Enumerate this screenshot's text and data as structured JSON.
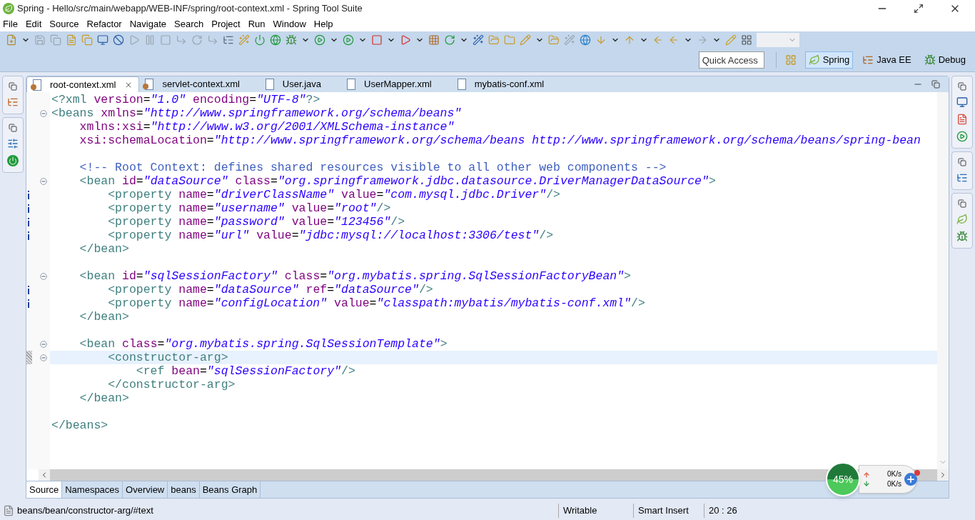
{
  "window": {
    "title": "Spring - Hello/src/main/webapp/WEB-INF/spring/root-context.xml - Spring Tool Suite"
  },
  "menu": [
    "File",
    "Edit",
    "Source",
    "Refactor",
    "Navigate",
    "Search",
    "Project",
    "Run",
    "Window",
    "Help"
  ],
  "quick_access": {
    "placeholder": "Quick Access"
  },
  "perspectives": [
    {
      "label": "Spring",
      "selected": true
    },
    {
      "label": "Java EE",
      "selected": false
    },
    {
      "label": "Debug",
      "selected": false
    }
  ],
  "editor_tabs": [
    {
      "label": "root-context.xml",
      "selected": true,
      "kind": "spring"
    },
    {
      "label": "servlet-context.xml",
      "selected": false,
      "kind": "spring"
    },
    {
      "label": "User.java",
      "selected": false,
      "kind": "java"
    },
    {
      "label": "UserMapper.xml",
      "selected": false,
      "kind": "xml"
    },
    {
      "label": "mybatis-conf.xml",
      "selected": false,
      "kind": "xml"
    }
  ],
  "code_lines": [
    {
      "fold": false,
      "info": false,
      "current": false,
      "changed": false,
      "segments": [
        {
          "kind": "tag",
          "text": "<?xml"
        },
        {
          "kind": "attr",
          "text": " version"
        },
        {
          "kind": "plain",
          "text": "="
        },
        {
          "kind": "value",
          "text": "\"1.0\""
        },
        {
          "kind": "attr",
          "text": " encoding"
        },
        {
          "kind": "plain",
          "text": "="
        },
        {
          "kind": "value",
          "text": "\"UTF-8\""
        },
        {
          "kind": "tag",
          "text": "?>"
        }
      ]
    },
    {
      "fold": true,
      "info": false,
      "current": false,
      "changed": false,
      "segments": [
        {
          "kind": "tag",
          "text": "<beans"
        },
        {
          "kind": "attr",
          "text": " xmlns"
        },
        {
          "kind": "plain",
          "text": "="
        },
        {
          "kind": "value",
          "text": "\"http://www.springframework.org/schema/beans\""
        }
      ]
    },
    {
      "fold": false,
      "info": false,
      "current": false,
      "changed": false,
      "segments": [
        {
          "kind": "attr",
          "text": "    xmlns:xsi"
        },
        {
          "kind": "plain",
          "text": "="
        },
        {
          "kind": "value",
          "text": "\"http://www.w3.org/2001/XMLSchema-instance\""
        }
      ]
    },
    {
      "fold": false,
      "info": false,
      "current": false,
      "changed": false,
      "segments": [
        {
          "kind": "attr",
          "text": "    xsi:schemaLocation"
        },
        {
          "kind": "plain",
          "text": "="
        },
        {
          "kind": "value",
          "text": "\"http://www.springframework.org/schema/beans http://www.springframework.org/schema/beans/spring-bean"
        }
      ]
    },
    {
      "fold": false,
      "info": false,
      "current": false,
      "changed": false
    },
    {
      "fold": false,
      "info": false,
      "current": false,
      "changed": false,
      "segments": [
        {
          "kind": "comment",
          "text": "    <!-- Root Context: defines shared resources visible to all other web components -->"
        }
      ]
    },
    {
      "fold": true,
      "info": false,
      "current": false,
      "changed": false,
      "segments": [
        {
          "kind": "tag",
          "text": "    <bean"
        },
        {
          "kind": "attr",
          "text": " id"
        },
        {
          "kind": "plain",
          "text": "="
        },
        {
          "kind": "value",
          "text": "\"dataSource\""
        },
        {
          "kind": "attr",
          "text": " class"
        },
        {
          "kind": "plain",
          "text": "="
        },
        {
          "kind": "value",
          "text": "\"org.springframework.jdbc.datasource.DriverManagerDataSource\""
        },
        {
          "kind": "tag",
          "text": ">"
        }
      ]
    },
    {
      "fold": false,
      "info": true,
      "current": false,
      "changed": false,
      "segments": [
        {
          "kind": "tag",
          "text": "        <property"
        },
        {
          "kind": "attr",
          "text": " name"
        },
        {
          "kind": "plain",
          "text": "="
        },
        {
          "kind": "value",
          "text": "\"driverClassName\""
        },
        {
          "kind": "attr",
          "text": " value"
        },
        {
          "kind": "plain",
          "text": "="
        },
        {
          "kind": "value",
          "text": "\"com.mysql.jdbc.Driver\""
        },
        {
          "kind": "tag",
          "text": "/>"
        }
      ]
    },
    {
      "fold": false,
      "info": true,
      "current": false,
      "changed": false,
      "segments": [
        {
          "kind": "tag",
          "text": "        <property"
        },
        {
          "kind": "attr",
          "text": " name"
        },
        {
          "kind": "plain",
          "text": "="
        },
        {
          "kind": "value",
          "text": "\"username\""
        },
        {
          "kind": "attr",
          "text": " value"
        },
        {
          "kind": "plain",
          "text": "="
        },
        {
          "kind": "value",
          "text": "\"root\""
        },
        {
          "kind": "tag",
          "text": "/>"
        }
      ]
    },
    {
      "fold": false,
      "info": true,
      "current": false,
      "changed": false,
      "segments": [
        {
          "kind": "tag",
          "text": "        <property"
        },
        {
          "kind": "attr",
          "text": " name"
        },
        {
          "kind": "plain",
          "text": "="
        },
        {
          "kind": "value",
          "text": "\"password\""
        },
        {
          "kind": "attr",
          "text": " value"
        },
        {
          "kind": "plain",
          "text": "="
        },
        {
          "kind": "value",
          "text": "\"123456\""
        },
        {
          "kind": "tag",
          "text": "/>"
        }
      ]
    },
    {
      "fold": false,
      "info": true,
      "current": false,
      "changed": false,
      "segments": [
        {
          "kind": "tag",
          "text": "        <property"
        },
        {
          "kind": "attr",
          "text": " name"
        },
        {
          "kind": "plain",
          "text": "="
        },
        {
          "kind": "value",
          "text": "\"url\""
        },
        {
          "kind": "attr",
          "text": " value"
        },
        {
          "kind": "plain",
          "text": "="
        },
        {
          "kind": "value",
          "text": "\"jdbc:mysql://localhost:3306/test\""
        },
        {
          "kind": "tag",
          "text": "/>"
        }
      ]
    },
    {
      "fold": false,
      "info": false,
      "current": false,
      "changed": false,
      "segments": [
        {
          "kind": "tag",
          "text": "    </bean>"
        }
      ]
    },
    {
      "fold": false,
      "info": false,
      "current": false,
      "changed": false
    },
    {
      "fold": true,
      "info": false,
      "current": false,
      "changed": false,
      "segments": [
        {
          "kind": "tag",
          "text": "    <bean"
        },
        {
          "kind": "attr",
          "text": " id"
        },
        {
          "kind": "plain",
          "text": "="
        },
        {
          "kind": "value",
          "text": "\"sqlSessionFactory\""
        },
        {
          "kind": "attr",
          "text": " class"
        },
        {
          "kind": "plain",
          "text": "="
        },
        {
          "kind": "value",
          "text": "\"org.mybatis.spring.SqlSessionFactoryBean\""
        },
        {
          "kind": "tag",
          "text": ">"
        }
      ]
    },
    {
      "fold": false,
      "info": true,
      "current": false,
      "changed": false,
      "segments": [
        {
          "kind": "tag",
          "text": "        <property"
        },
        {
          "kind": "attr",
          "text": " name"
        },
        {
          "kind": "plain",
          "text": "="
        },
        {
          "kind": "value",
          "text": "\"dataSource\""
        },
        {
          "kind": "attr",
          "text": " ref"
        },
        {
          "kind": "plain",
          "text": "="
        },
        {
          "kind": "value",
          "text": "\"dataSource\""
        },
        {
          "kind": "tag",
          "text": "/>"
        }
      ]
    },
    {
      "fold": false,
      "info": true,
      "current": false,
      "changed": false,
      "segments": [
        {
          "kind": "tag",
          "text": "        <property"
        },
        {
          "kind": "attr",
          "text": " name"
        },
        {
          "kind": "plain",
          "text": "="
        },
        {
          "kind": "value",
          "text": "\"configLocation\""
        },
        {
          "kind": "attr",
          "text": " value"
        },
        {
          "kind": "plain",
          "text": "="
        },
        {
          "kind": "value",
          "text": "\"classpath:mybatis/mybatis-conf.xml\""
        },
        {
          "kind": "tag",
          "text": "/>"
        }
      ]
    },
    {
      "fold": false,
      "info": false,
      "current": false,
      "changed": false,
      "segments": [
        {
          "kind": "tag",
          "text": "    </bean>"
        }
      ]
    },
    {
      "fold": false,
      "info": false,
      "current": false,
      "changed": false
    },
    {
      "fold": true,
      "info": false,
      "current": false,
      "changed": false,
      "segments": [
        {
          "kind": "tag",
          "text": "    <bean"
        },
        {
          "kind": "attr",
          "text": " class"
        },
        {
          "kind": "plain",
          "text": "="
        },
        {
          "kind": "value",
          "text": "\"org.mybatis.spring.SqlSessionTemplate\""
        },
        {
          "kind": "tag",
          "text": ">"
        }
      ]
    },
    {
      "fold": true,
      "info": false,
      "current": true,
      "changed": true,
      "segments": [
        {
          "kind": "tag",
          "text": "        <constructor-arg>"
        }
      ]
    },
    {
      "fold": false,
      "info": false,
      "current": false,
      "changed": false,
      "segments": [
        {
          "kind": "tag",
          "text": "            <ref"
        },
        {
          "kind": "attr",
          "text": " bean"
        },
        {
          "kind": "plain",
          "text": "="
        },
        {
          "kind": "value",
          "text": "\"sqlSessionFactory\""
        },
        {
          "kind": "tag",
          "text": "/>"
        }
      ]
    },
    {
      "fold": false,
      "info": false,
      "current": false,
      "changed": false,
      "segments": [
        {
          "kind": "tag",
          "text": "        </constructor-arg>"
        }
      ]
    },
    {
      "fold": false,
      "info": false,
      "current": false,
      "changed": false,
      "segments": [
        {
          "kind": "tag",
          "text": "    </bean>"
        }
      ]
    },
    {
      "fold": false,
      "info": false,
      "current": false,
      "changed": false
    },
    {
      "fold": false,
      "info": false,
      "current": false,
      "changed": false,
      "segments": [
        {
          "kind": "tag",
          "text": "</beans>"
        }
      ]
    }
  ],
  "bottom_tabs": [
    {
      "label": "Source",
      "selected": true
    },
    {
      "label": "Namespaces",
      "selected": false
    },
    {
      "label": "Overview",
      "selected": false
    },
    {
      "label": "beans",
      "selected": false
    },
    {
      "label": "Beans Graph",
      "selected": false
    }
  ],
  "net_meter": {
    "percent": "45%",
    "upload": "0K/s",
    "download": "0K/s"
  },
  "status_bar": {
    "path": "beans/bean/constructor-arg/#text",
    "mode": "Writable",
    "insert": "Smart Insert",
    "position": "20 : 26"
  }
}
